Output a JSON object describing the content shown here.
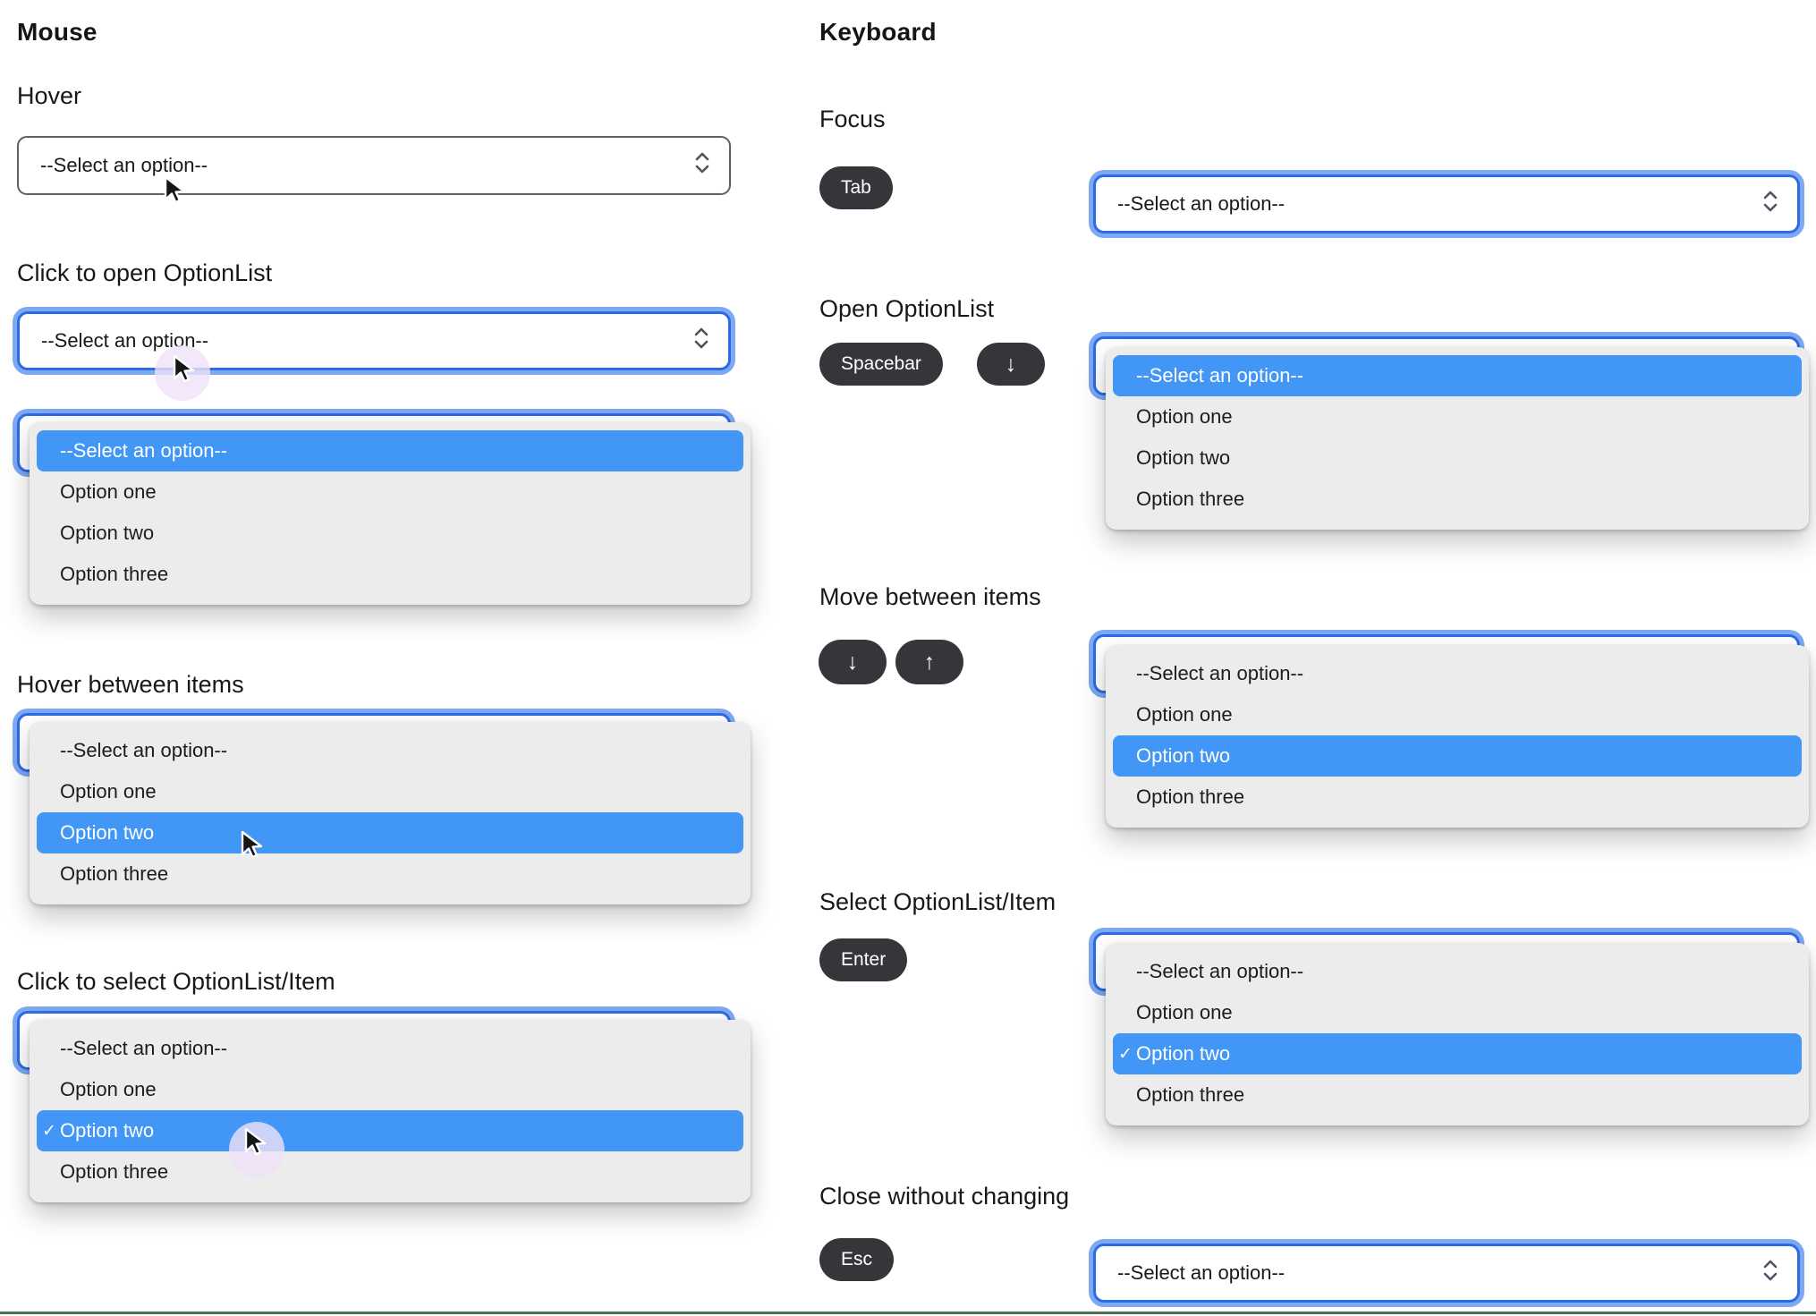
{
  "select": {
    "placeholder": "--Select an option--"
  },
  "options": [
    "--Select an option--",
    "Option one",
    "Option two",
    "Option three"
  ],
  "check_glyph": "✓",
  "mouse": {
    "title": "Mouse",
    "sections": [
      {
        "label": "Hover"
      },
      {
        "label": "Click to open OptionList"
      },
      {
        "label": "Hover between items"
      },
      {
        "label": "Click to select OptionList/Item"
      }
    ]
  },
  "keyboard": {
    "title": "Keyboard",
    "sections": [
      {
        "label": "Focus",
        "keys": [
          "Tab"
        ]
      },
      {
        "label": "Open OptionList",
        "keys": [
          "Spacebar",
          "↓"
        ]
      },
      {
        "label": "Move between items",
        "keys": [
          "↓",
          "↑"
        ]
      },
      {
        "label": "Select OptionList/Item",
        "keys": [
          "Enter"
        ]
      },
      {
        "label": "Close without changing",
        "keys": [
          "Esc"
        ]
      }
    ]
  },
  "colors": {
    "highlight_blue": "#4196F6",
    "focus_border_blue": "#2D6BE4",
    "focus_ring_blue": "#7DA8F2",
    "list_background": "#ECECEC",
    "select_border": "#5A616C",
    "key_pill_background": "#353639",
    "bottom_rule_green": "#4B7157"
  }
}
